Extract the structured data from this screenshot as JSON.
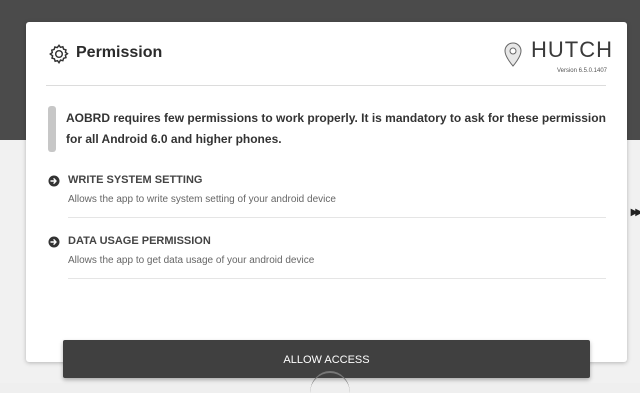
{
  "header": {
    "title": "Permission",
    "icon": "gear-icon",
    "brand": "HUTCH",
    "version": "Version 6.5.0.1407"
  },
  "notice": "AOBRD requires few permissions to work properly. It is mandatory to ask for these permission for all Android 6.0 and higher phones.",
  "permissions": [
    {
      "title": "WRITE SYSTEM SETTING",
      "description": "Allows the app to write system setting of your android device",
      "icon": "arrow-right-circle-icon"
    },
    {
      "title": "DATA USAGE PERMISSION",
      "description": "Allows the app to get data usage of your android device",
      "icon": "arrow-right-circle-icon"
    }
  ],
  "actions": {
    "allow_label": "ALLOW ACCESS"
  },
  "colors": {
    "dark_bg": "#4b4b4b",
    "card_bg": "#ffffff",
    "button_bg": "#404040"
  }
}
